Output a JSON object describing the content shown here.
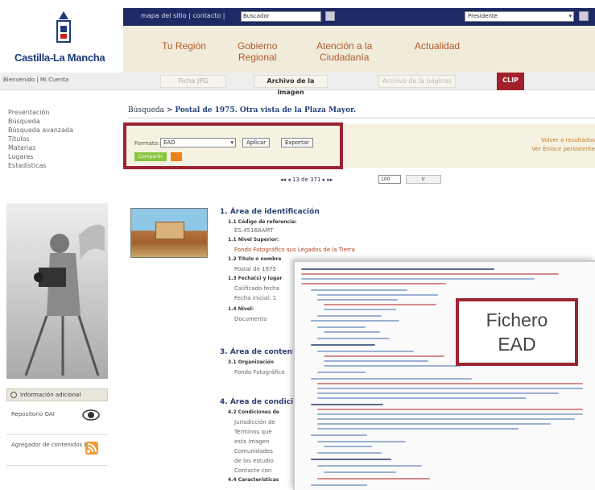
{
  "header": {
    "logo_text": "Castilla-La Mancha",
    "top_links": "mapa del sitio | contacto |",
    "search_placeholder": "Buscador",
    "select_value": "Presidente",
    "nav": [
      {
        "line1": "Tu Región",
        "line2": ""
      },
      {
        "line1": "Gobierno",
        "line2": "Regional"
      },
      {
        "line1": "Atención a la",
        "line2": "Ciudadanía"
      },
      {
        "line1": "Actualidad",
        "line2": ""
      }
    ]
  },
  "subbar": {
    "breadcrumb": "Bienvenido | Mi Cuenta",
    "tabs": [
      "Ficha JPG",
      "Archivo de la imagen",
      "Archivo de la páginas"
    ],
    "clip_label": "CLIP"
  },
  "sidebar": {
    "menu": [
      "Presentación",
      "Búsqueda",
      "Búsqueda avanzada",
      "Títulos",
      "Materias",
      "Lugares",
      "Estadísticas"
    ],
    "info_heading": "Información adicional",
    "repo_label": "Repositorio OAI",
    "rss_label": "Agregador de contenidos RSS"
  },
  "content": {
    "title_prefix": "Búsqueda >",
    "title": "Postal de 1975. Otra vista de la Plaza Mayor.",
    "format_label": "Formato:",
    "format_value": "EAD",
    "apply_label": "Aplicar",
    "export_label": "Exportar",
    "green_label": "Compartir",
    "right_link1": "Volver a resultados",
    "right_link2": "Ver Enlace persistente",
    "pager_text": "◂◂  ◂  13 de 371  ▸  ▸▸",
    "pager_input": "100",
    "pager_go": "Ir",
    "sections": [
      {
        "heading": "1. Área de identificación"
      },
      {
        "heading": "3. Área de contenido"
      },
      {
        "heading": "4. Área de condiciones"
      }
    ],
    "items": [
      {
        "label": "1.1 Código de referencia:",
        "value": "ES.45168AMT"
      },
      {
        "label": "1.1 Nivel Superior:",
        "value": "Fondo Fotográfico sus Legados de la Tierra"
      },
      {
        "label": "1.2 Título o nombre",
        "value": "Postal de 1975"
      },
      {
        "label": "1.3 Fecha(s) y lugar",
        "value": "Calificado fecha"
      },
      {
        "label": "",
        "value": "Fecha inicial: 1"
      },
      {
        "label": "1.4 Nivel:",
        "value": "Documento"
      },
      {
        "label": "3.1 Organización",
        "value": "Fondo Fotográfico"
      },
      {
        "label": "4.2 Condiciones de",
        "value": "Jurisdicción de"
      },
      {
        "label": "",
        "value": "Términos que"
      },
      {
        "label": "",
        "value": "esta imagen"
      },
      {
        "label": "",
        "value": "Comunidades"
      },
      {
        "label": "",
        "value": "de los estudio"
      },
      {
        "label": "",
        "value": "Contacte con"
      },
      {
        "label": "4.4 Características",
        "value": ""
      }
    ]
  },
  "overlay": {
    "label_line1": "Fichero",
    "label_line2": "EAD"
  },
  "colors": {
    "navy": "#1e2a63",
    "accent_red": "#9c2334",
    "nav_text": "#b0582a",
    "nav_bg": "#f1ecd9"
  }
}
